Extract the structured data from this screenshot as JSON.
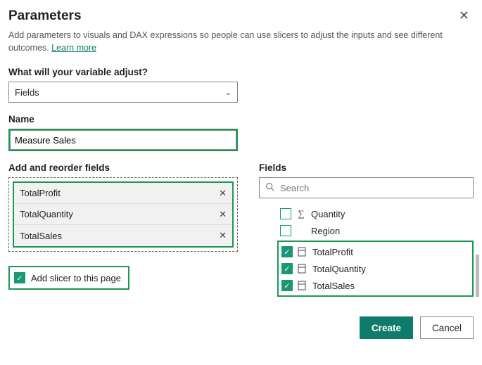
{
  "header": {
    "title": "Parameters",
    "description_pre": "Add parameters to visuals and DAX expressions so people can use slicers to adjust the inputs and see different outcomes. ",
    "learn_more": "Learn more"
  },
  "adjust": {
    "label": "What will your variable adjust?",
    "value": "Fields"
  },
  "name": {
    "label": "Name",
    "value": "Measure Sales"
  },
  "reorder": {
    "label": "Add and reorder fields",
    "items": [
      "TotalProfit",
      "TotalQuantity",
      "TotalSales"
    ]
  },
  "slicer": {
    "label": "Add slicer to this page",
    "checked": true
  },
  "fields": {
    "label": "Fields",
    "search_placeholder": "Search",
    "tree": {
      "unchecked": [
        {
          "label": "Quantity",
          "icon": "sigma"
        },
        {
          "label": "Region",
          "icon": "none"
        }
      ],
      "checked": [
        {
          "label": "TotalProfit"
        },
        {
          "label": "TotalQuantity"
        },
        {
          "label": "TotalSales"
        }
      ]
    }
  },
  "footer": {
    "create": "Create",
    "cancel": "Cancel"
  }
}
